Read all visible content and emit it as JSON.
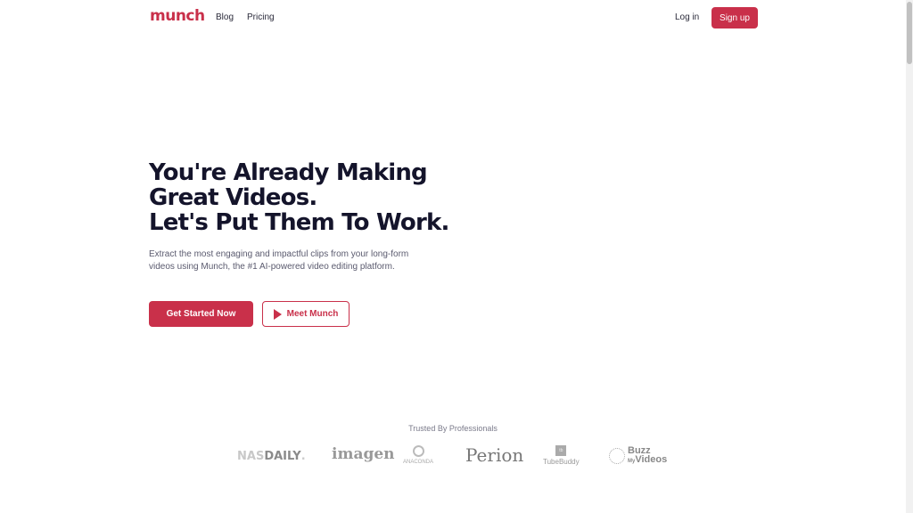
{
  "nav": {
    "logo": "munch",
    "links": [
      "Blog",
      "Pricing"
    ],
    "login": "Log in",
    "signup": "Sign up"
  },
  "hero": {
    "title_lines": [
      "You're Already Making",
      "Great Videos.",
      "Let's Put Them To Work."
    ],
    "subtitle": "Extract the most engaging and impactful clips from your long-form videos using Munch, the #1 AI-powered video editing platform.",
    "primary_cta": "Get Started Now",
    "secondary_cta": "Meet Munch"
  },
  "trusted": {
    "heading": "Trusted By Professionals",
    "logos": {
      "nas_a": "NAS",
      "nas_b": "DAILY",
      "imagen": "imagen",
      "anaconda": "ANACONDA",
      "perion": "Perion",
      "tubebuddy": "TubeBuddy",
      "tb_icon": "tb",
      "buzz": "Buzz",
      "my": "My",
      "videos": "Videos"
    }
  },
  "colors": {
    "accent": "#c9304a",
    "heading": "#14142b"
  }
}
